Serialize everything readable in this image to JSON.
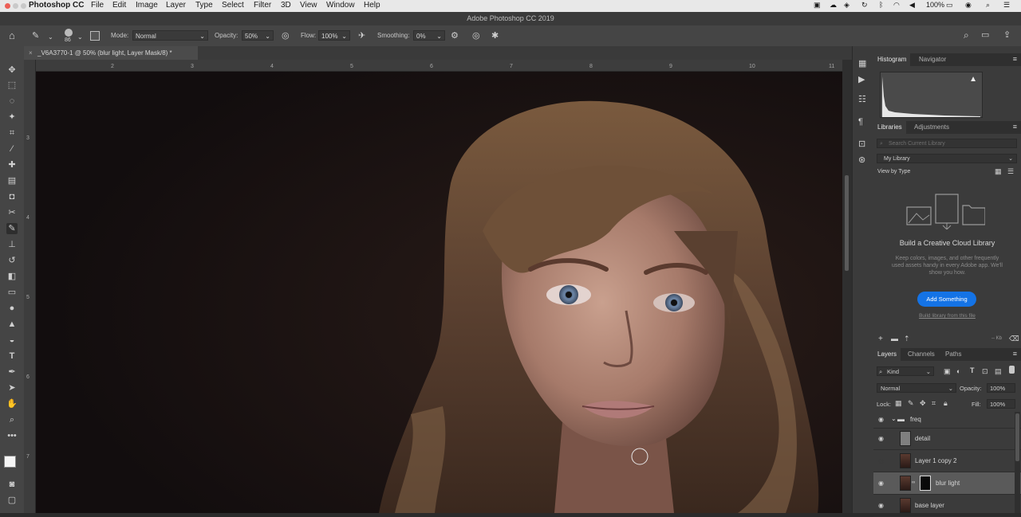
{
  "menubar": {
    "app": "Photoshop CC",
    "items": [
      "File",
      "Edit",
      "Image",
      "Layer",
      "Type",
      "Select",
      "Filter",
      "3D",
      "View",
      "Window",
      "Help"
    ],
    "battery": "100%"
  },
  "titlebar": {
    "title": "Adobe Photoshop CC 2019"
  },
  "options": {
    "brush_size": "86",
    "mode_label": "Mode:",
    "mode_value": "Normal",
    "opacity_label": "Opacity:",
    "opacity_value": "50%",
    "flow_label": "Flow:",
    "flow_value": "100%",
    "smoothing_label": "Smoothing:",
    "smoothing_value": "0%"
  },
  "document": {
    "tab_title": "_V6A3770-1 @ 50% (blur light, Layer Mask/8) *",
    "ruler_h": [
      "2",
      "3",
      "4",
      "5",
      "6",
      "7",
      "8",
      "9",
      "10",
      "11"
    ],
    "ruler_v": [
      "3",
      "4",
      "5",
      "6",
      "7"
    ]
  },
  "panels": {
    "top_tabs": [
      "Histogram",
      "Navigator"
    ],
    "lib_tabs": [
      "Libraries",
      "Adjustments"
    ],
    "lib_search_placeholder": "Search Current Library",
    "lib_name": "My Library",
    "view_by": "View by Type",
    "cc_title": "Build a Creative Cloud Library",
    "cc_desc": "Keep colors, images, and other frequently used assets handy in every Adobe app. We'll show you how.",
    "add_button": "Add Something",
    "build_link": "Build library from this file",
    "lib_size": "-- Kb",
    "layer_tabs": [
      "Layers",
      "Channels",
      "Paths"
    ],
    "kind_label": "Kind",
    "blend_mode": "Normal",
    "opacity_label": "Opacity:",
    "opacity_value": "100%",
    "lock_label": "Lock:",
    "fill_label": "Fill:",
    "fill_value": "100%",
    "layers": [
      {
        "name": "freq",
        "visible": true,
        "type": "group"
      },
      {
        "name": "detail",
        "visible": true,
        "type": "gray"
      },
      {
        "name": "Layer 1 copy 2",
        "visible": false,
        "type": "photo"
      },
      {
        "name": "blur light",
        "visible": true,
        "type": "photo-mask",
        "selected": true
      },
      {
        "name": "base layer",
        "visible": true,
        "type": "photo"
      }
    ]
  }
}
